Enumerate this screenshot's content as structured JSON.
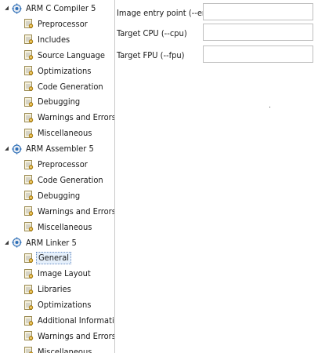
{
  "tree": {
    "groups": [
      {
        "label": "ARM C Compiler 5",
        "children": [
          "Preprocessor",
          "Includes",
          "Source Language",
          "Optimizations",
          "Code Generation",
          "Debugging",
          "Warnings and Errors",
          "Miscellaneous"
        ]
      },
      {
        "label": "ARM Assembler 5",
        "children": [
          "Preprocessor",
          "Code Generation",
          "Debugging",
          "Warnings and Errors",
          "Miscellaneous"
        ]
      },
      {
        "label": "ARM Linker 5",
        "children": [
          "General",
          "Image Layout",
          "Libraries",
          "Optimizations",
          "Additional Information",
          "Warnings and Errors",
          "Miscellaneous"
        ]
      }
    ],
    "selected": "General"
  },
  "form": {
    "fields": [
      {
        "label": "Image entry point (--entry)",
        "value": ""
      },
      {
        "label": "Target CPU (--cpu)",
        "value": ""
      },
      {
        "label": "Target FPU (--fpu)",
        "value": ""
      }
    ]
  },
  "icons": {
    "group": "tool-gear-icon",
    "page": "settings-page-icon",
    "expanded": "triangle-down-icon"
  },
  "colors": {
    "selection_bg": "#e6f0fb",
    "icon_accent": "#d9a520",
    "icon_blue": "#2d6fb7"
  }
}
